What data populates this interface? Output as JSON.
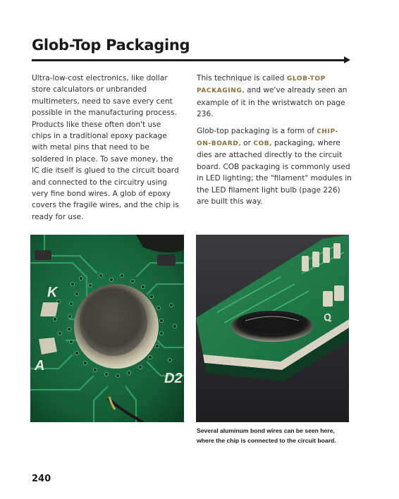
{
  "page": {
    "title": "Glob-Top Packaging",
    "page_number": "240"
  },
  "left_column": {
    "paragraph": "Ultra-low-cost electronics, like dollar store calculators or unbranded multimeters, need to save every cent possible in the manufacturing process. Products like these often don't use chips in a traditional epoxy package with metal pins that need to be soldered in place. To save money, the IC die itself is glued to the circuit board and connected to the circuitry using very fine bond wires. A glob of epoxy covers the fragile wires, and the chip is ready for use."
  },
  "right_column": {
    "p1_a": "This technique is called ",
    "p1_term": "GLOB-TOP PACKAGING",
    "p1_b": ", and we've already seen an example of it in the wristwatch on page 236.",
    "p2_a": "Glob-top packaging is a form of ",
    "p2_term1": "CHIP-ON-BOARD",
    "p2_b": ", or ",
    "p2_term2": "COB",
    "p2_c": ", packaging, where dies are attached directly to the circuit board. COB packaging is commonly used in LED lighting; the \"filament\" modules in the LED filament light bulb (page 226) are built this way."
  },
  "figures": {
    "left_photo_labels": [
      "K",
      "A",
      "D2"
    ],
    "right_photo_label": "Q",
    "caption_line1": "Several aluminum bond wires can be seen here,",
    "caption_line2": "where the chip is connected to the circuit board."
  }
}
